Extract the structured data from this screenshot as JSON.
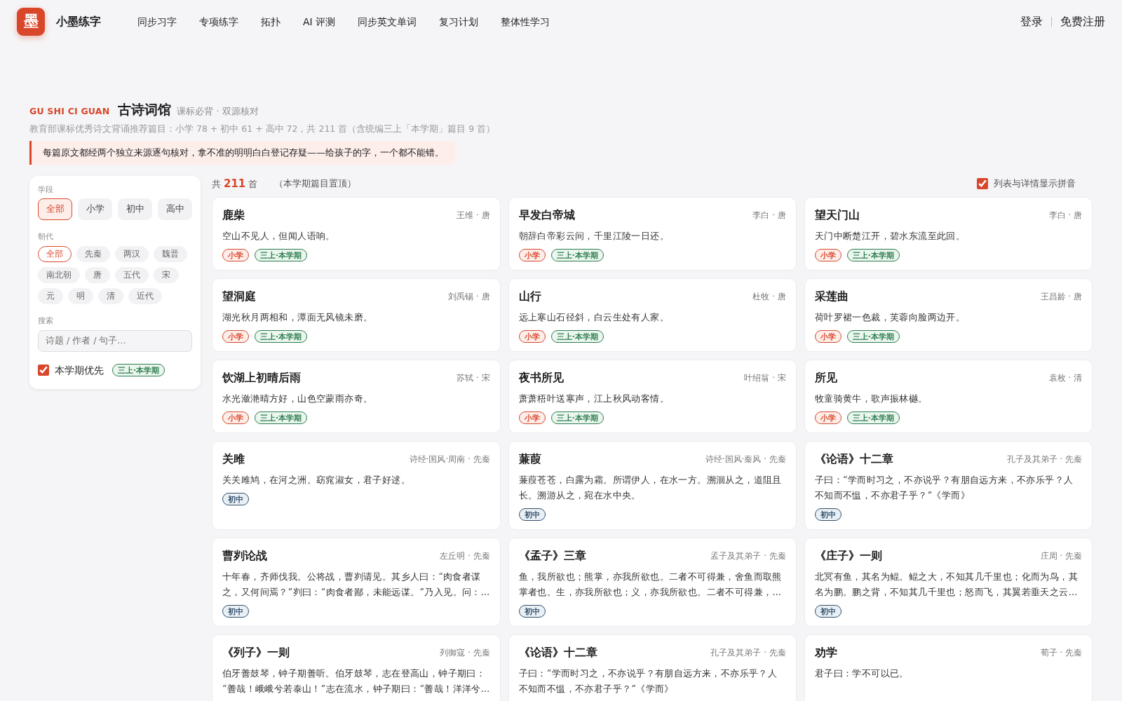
{
  "nav": {
    "logo_glyph": "墨",
    "brand": "小墨练字",
    "links": [
      "同步习字",
      "专项练字",
      "拓扑",
      "AI 评测",
      "同步英文单词",
      "复习计划",
      "整体性学习"
    ],
    "login": "登录",
    "register": "免费注册"
  },
  "heading": {
    "latin": "GU SHI CI GUAN",
    "title": "古诗词馆",
    "tagline": "课标必背 · 双源核对",
    "summary": "教育部课标优秀诗文背诵推荐篇目：小学 78 + 初中 61 + 高中 72，共 211 首（含统编三上「本学期」篇目 9 首）",
    "notice": "每篇原文都经两个独立来源逐句核对，拿不准的明明白白登记存疑——给孩子的字，一个都不能错。"
  },
  "filters": {
    "stage_label": "学段",
    "stages": [
      {
        "label": "全部",
        "selected": true
      },
      {
        "label": "小学",
        "selected": false
      },
      {
        "label": "初中",
        "selected": false
      },
      {
        "label": "高中",
        "selected": false
      }
    ],
    "dynasty_label": "朝代",
    "dynasties": [
      {
        "label": "全部",
        "selected": true
      },
      {
        "label": "先秦",
        "selected": false
      },
      {
        "label": "两汉",
        "selected": false
      },
      {
        "label": "魏晋",
        "selected": false
      },
      {
        "label": "南北朝",
        "selected": false
      },
      {
        "label": "唐",
        "selected": false
      },
      {
        "label": "五代",
        "selected": false
      },
      {
        "label": "宋",
        "selected": false
      },
      {
        "label": "元",
        "selected": false
      },
      {
        "label": "明",
        "selected": false
      },
      {
        "label": "清",
        "selected": false
      },
      {
        "label": "近代",
        "selected": false
      }
    ],
    "search_label": "搜索",
    "search": {
      "placeholder": "诗题 / 作者 / 句子…"
    },
    "term_first": {
      "label": "本学期优先",
      "checked": true,
      "tag": "三上·本学期"
    }
  },
  "list": {
    "count_prefix": "共",
    "count": "211",
    "count_suffix": "首",
    "note": "（本学期篇目置顶）",
    "pinyin": {
      "label": "列表与详情显示拼音",
      "checked": true
    }
  },
  "poems": [
    {
      "title": "鹿柴",
      "author": "王维 · 唐",
      "lines": [
        "空山不见人，但闻人语响。"
      ],
      "tags": [
        {
          "label": "小学",
          "kind": "primary"
        },
        {
          "label": "三上·本学期",
          "kind": "term"
        }
      ]
    },
    {
      "title": "早发白帝城",
      "author": "李白 · 唐",
      "lines": [
        "朝辞白帝彩云间，千里江陵一日还。"
      ],
      "tags": [
        {
          "label": "小学",
          "kind": "primary"
        },
        {
          "label": "三上·本学期",
          "kind": "term"
        }
      ]
    },
    {
      "title": "望天门山",
      "author": "李白 · 唐",
      "lines": [
        "天门中断楚江开，碧水东流至此回。"
      ],
      "tags": [
        {
          "label": "小学",
          "kind": "primary"
        },
        {
          "label": "三上·本学期",
          "kind": "term"
        }
      ]
    },
    {
      "title": "望洞庭",
      "author": "刘禹锡 · 唐",
      "lines": [
        "湖光秋月两相和，潭面无风镜未磨。"
      ],
      "tags": [
        {
          "label": "小学",
          "kind": "primary"
        },
        {
          "label": "三上·本学期",
          "kind": "term"
        }
      ]
    },
    {
      "title": "山行",
      "author": "杜牧 · 唐",
      "lines": [
        "远上寒山石径斜，白云生处有人家。"
      ],
      "tags": [
        {
          "label": "小学",
          "kind": "primary"
        },
        {
          "label": "三上·本学期",
          "kind": "term"
        }
      ]
    },
    {
      "title": "采莲曲",
      "author": "王昌龄 · 唐",
      "lines": [
        "荷叶罗裙一色裁，芙蓉向脸两边开。"
      ],
      "tags": [
        {
          "label": "小学",
          "kind": "primary"
        },
        {
          "label": "三上·本学期",
          "kind": "term"
        }
      ]
    },
    {
      "title": "饮湖上初晴后雨",
      "author": "苏轼 · 宋",
      "lines": [
        "水光潋滟晴方好，山色空蒙雨亦奇。"
      ],
      "tags": [
        {
          "label": "小学",
          "kind": "primary"
        },
        {
          "label": "三上·本学期",
          "kind": "term"
        }
      ]
    },
    {
      "title": "夜书所见",
      "author": "叶绍翁 · 宋",
      "lines": [
        "萧萧梧叶送寒声，江上秋风动客情。"
      ],
      "tags": [
        {
          "label": "小学",
          "kind": "primary"
        },
        {
          "label": "三上·本学期",
          "kind": "term"
        }
      ]
    },
    {
      "title": "所见",
      "author": "袁枚 · 清",
      "lines": [
        "牧童骑黄牛，歌声振林樾。"
      ],
      "tags": [
        {
          "label": "小学",
          "kind": "primary"
        },
        {
          "label": "三上·本学期",
          "kind": "term"
        }
      ]
    },
    {
      "title": "关雎",
      "author": "诗经·国风·周南 · 先秦",
      "lines": [
        "关关雎鸠，在河之洲。窈窕淑女，君子好逑。"
      ],
      "tags": [
        {
          "label": "初中",
          "kind": "junior"
        }
      ]
    },
    {
      "title": "蒹葭",
      "author": "诗经·国风·秦风 · 先秦",
      "lines": [
        "蒹葭苍苍，白露为霜。所谓伊人，在水一方。溯洄从之，道阻且",
        "长。溯游从之，宛在水中央。"
      ],
      "tags": [
        {
          "label": "初中",
          "kind": "junior"
        }
      ]
    },
    {
      "title": "《论语》十二章",
      "author": "孔子及其弟子 · 先秦",
      "lines": [
        "子曰：“学而时习之，不亦说乎？有朋自远方来，不亦乐乎？人",
        "不知而不愠，不亦君子乎？”《学而》"
      ],
      "tags": [
        {
          "label": "初中",
          "kind": "junior"
        }
      ]
    },
    {
      "title": "曹刿论战",
      "author": "左丘明 · 先秦",
      "lines": [
        "十年春，齐师伐我。公将战，曹刿请见。其乡人曰：“肉食者谋",
        "之，又何间焉？”刿曰：“肉食者鄙，未能远谋。”乃入见。问：…"
      ],
      "tags": [
        {
          "label": "初中",
          "kind": "junior"
        }
      ]
    },
    {
      "title": "《孟子》三章",
      "author": "孟子及其弟子 · 先秦",
      "lines": [
        "鱼，我所欲也；熊掌，亦我所欲也。二者不可得兼，舍鱼而取熊",
        "掌者也。生，亦我所欲也；义，亦我所欲也。二者不可得兼，…"
      ],
      "tags": [
        {
          "label": "初中",
          "kind": "junior"
        }
      ]
    },
    {
      "title": "《庄子》一则",
      "author": "庄周 · 先秦",
      "lines": [
        "北冥有鱼，其名为鲲。鲲之大，不知其几千里也；化而为鸟，其",
        "名为鹏。鹏之背，不知其几千里也；怒而飞，其翼若垂天之云…"
      ],
      "tags": [
        {
          "label": "初中",
          "kind": "junior"
        }
      ]
    },
    {
      "title": "《列子》一则",
      "author": "列御寇 · 先秦",
      "lines": [
        "伯牙善鼓琴，钟子期善听。伯牙鼓琴，志在登高山，钟子期曰：",
        "“善哉！峨峨兮若泰山！”志在流水，钟子期曰：“善哉！洋洋兮…"
      ]
    },
    {
      "title": "《论语》十二章",
      "author": "孔子及其弟子 · 先秦",
      "lines": [
        "子曰：“学而时习之，不亦说乎？有朋自远方来，不亦乐乎？人",
        "不知而不愠，不亦君子乎？”《学而》"
      ]
    },
    {
      "title": "劝学",
      "author": "荀子 · 先秦",
      "lines": [
        "君子曰：学不可以已。"
      ]
    }
  ]
}
